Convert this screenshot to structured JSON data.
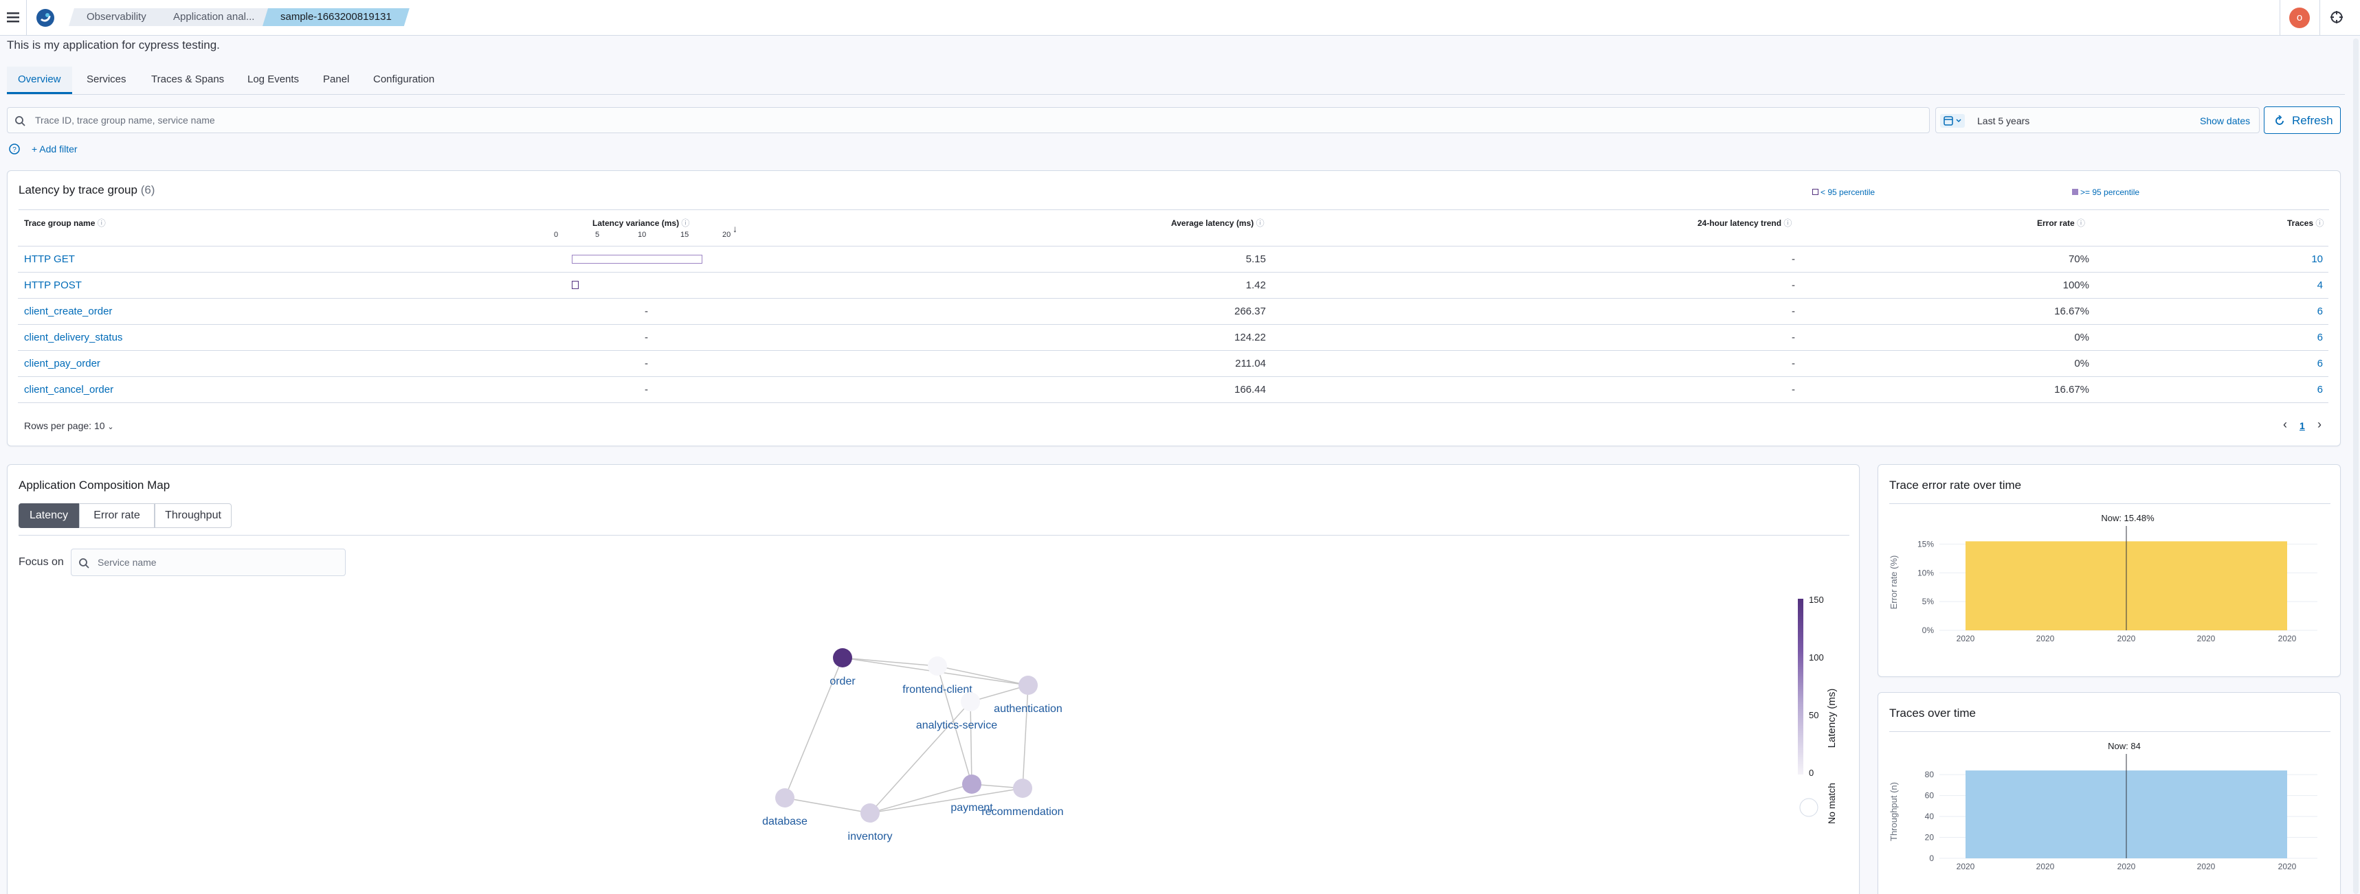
{
  "header": {
    "breadcrumbs": [
      "Observability",
      "Application anal...",
      "sample-1663200819131"
    ],
    "avatar_initial": "o"
  },
  "app_description": "This is my application for cypress testing.",
  "tabs": [
    "Overview",
    "Services",
    "Traces & Spans",
    "Log Events",
    "Panel",
    "Configuration"
  ],
  "search": {
    "placeholder": "Trace ID, trace group name, service name",
    "date_range": "Last 5 years",
    "show_dates": "Show dates",
    "refresh": "Refresh",
    "add_filter": "+ Add filter"
  },
  "latency_panel": {
    "title": "Latency by trace group",
    "count": "(6)",
    "legend_low": "< 95 percentile",
    "legend_high": ">= 95 percentile",
    "columns": {
      "name": "Trace group name",
      "variance": "Latency variance (ms)",
      "avg": "Average latency (ms)",
      "trend": "24-hour latency trend",
      "error": "Error rate",
      "traces": "Traces"
    },
    "variance_ticks": [
      "0",
      "5",
      "10",
      "15",
      "20"
    ],
    "rows": [
      {
        "name": "HTTP GET",
        "variance": "",
        "avg": "5.15",
        "trend": "-",
        "error": "70%",
        "traces": "10"
      },
      {
        "name": "HTTP POST",
        "variance": "",
        "avg": "1.42",
        "trend": "-",
        "error": "100%",
        "traces": "4"
      },
      {
        "name": "client_create_order",
        "variance": "-",
        "avg": "266.37",
        "trend": "-",
        "error": "16.67%",
        "traces": "6"
      },
      {
        "name": "client_delivery_status",
        "variance": "-",
        "avg": "124.22",
        "trend": "-",
        "error": "0%",
        "traces": "6"
      },
      {
        "name": "client_pay_order",
        "variance": "-",
        "avg": "211.04",
        "trend": "-",
        "error": "0%",
        "traces": "6"
      },
      {
        "name": "client_cancel_order",
        "variance": "-",
        "avg": "166.44",
        "trend": "-",
        "error": "16.67%",
        "traces": "6"
      }
    ],
    "rows_per_page": "Rows per page: 10",
    "page": "1"
  },
  "map_panel": {
    "title": "Application Composition Map",
    "modes": [
      "Latency",
      "Error rate",
      "Throughput"
    ],
    "focus_label": "Focus on",
    "service_placeholder": "Service name",
    "legend_ticks": [
      "150",
      "100",
      "50",
      "0"
    ],
    "legend_title": "Latency (ms)",
    "no_match": "No match",
    "nodes": [
      "order",
      "frontend-client",
      "authentication",
      "analytics-service",
      "payment",
      "recommendation",
      "database",
      "inventory"
    ]
  },
  "error_panel": {
    "title": "Trace error rate over time",
    "now": "Now: 15.48%",
    "ylabel": "Error rate (%)",
    "yticks": [
      "15%",
      "10%",
      "5%",
      "0%"
    ],
    "xticks": [
      "2020",
      "2020",
      "2020",
      "2020",
      "2020"
    ]
  },
  "traces_panel": {
    "title": "Traces over time",
    "now": "Now: 84",
    "ylabel": "Throughput (n)",
    "yticks": [
      "80",
      "60",
      "40",
      "20",
      "0"
    ],
    "xticks": [
      "2020",
      "2020",
      "2020",
      "2020",
      "2020"
    ]
  },
  "chart_data": [
    {
      "type": "bar",
      "title": "Trace error rate over time",
      "ylabel": "Error rate (%)",
      "ylim": [
        0,
        16
      ],
      "categories": [
        "2020"
      ],
      "values": [
        15.48
      ],
      "color": "#f8d25c"
    },
    {
      "type": "bar",
      "title": "Traces over time",
      "ylabel": "Throughput (n)",
      "ylim": [
        0,
        88
      ],
      "categories": [
        "2020"
      ],
      "values": [
        84
      ],
      "color": "#a2cdec"
    }
  ],
  "colors": {
    "accent": "#006bb8",
    "latency_high": "#54327f",
    "latency_low": "#d6d0e4"
  }
}
